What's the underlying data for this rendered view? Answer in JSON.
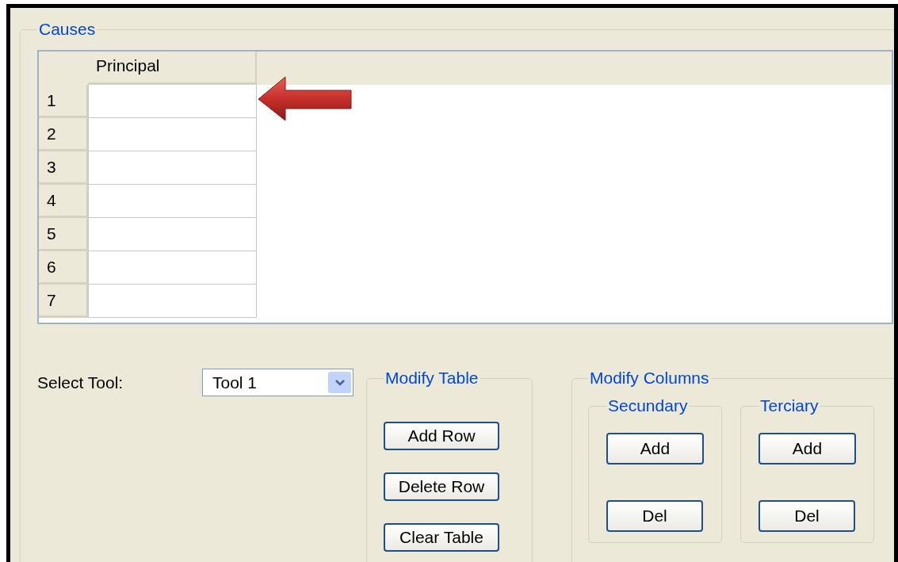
{
  "causes": {
    "title": "Causes",
    "table": {
      "columns": [
        "Principal"
      ],
      "rows": [
        {
          "number": "1"
        },
        {
          "number": "2"
        },
        {
          "number": "3"
        },
        {
          "number": "4"
        },
        {
          "number": "5"
        },
        {
          "number": "6"
        },
        {
          "number": "7"
        }
      ]
    }
  },
  "select_tool": {
    "label": "Select Tool:",
    "value": "Tool 1"
  },
  "modify_table": {
    "title": "Modify Table",
    "buttons": [
      "Add Row",
      "Delete Row",
      "Clear Table"
    ]
  },
  "modify_columns": {
    "title": "Modify Columns",
    "groups": [
      {
        "title": "Secundary",
        "buttons": [
          "Add",
          "Del"
        ]
      },
      {
        "title": "Terciary",
        "buttons": [
          "Add",
          "Del"
        ]
      }
    ]
  }
}
